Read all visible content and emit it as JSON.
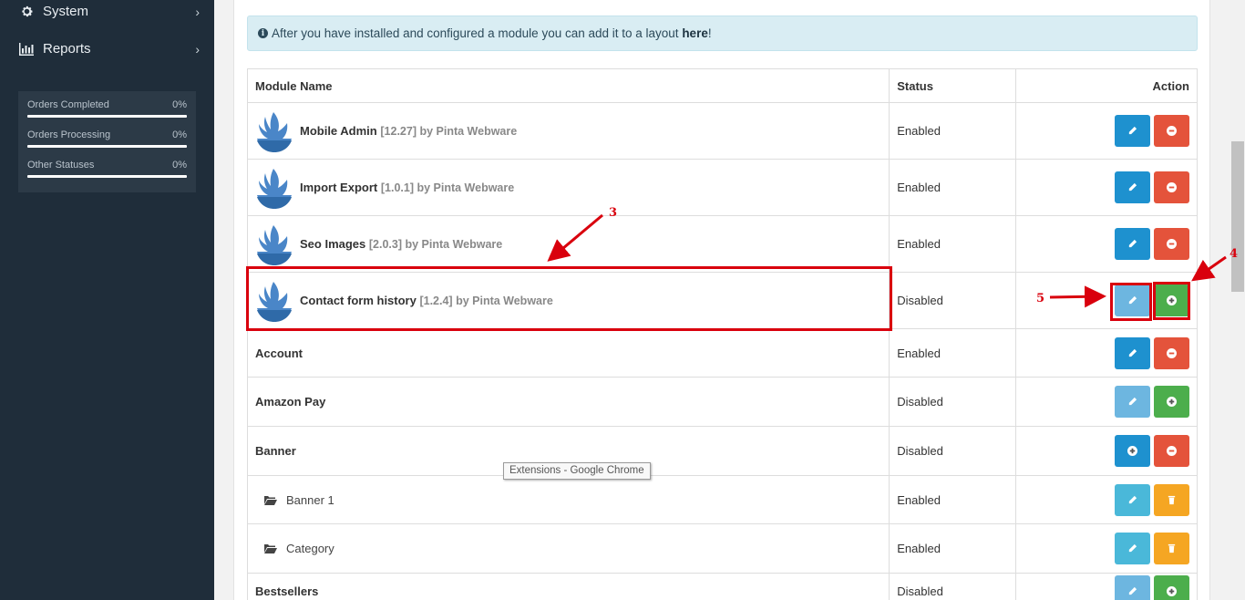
{
  "sidebar": {
    "items": [
      {
        "label": "System",
        "icon": "gear-icon"
      },
      {
        "label": "Reports",
        "icon": "bar-chart-icon"
      }
    ],
    "stats": [
      {
        "label": "Orders Completed",
        "value": "0%"
      },
      {
        "label": "Orders Processing",
        "value": "0%"
      },
      {
        "label": "Other Statuses",
        "value": "0%"
      }
    ]
  },
  "alert": {
    "text": "After you have installed and configured a module you can add it to a layout",
    "link": "here",
    "suffix": "!"
  },
  "table": {
    "headers": {
      "name": "Module Name",
      "status": "Status",
      "action": "Action"
    },
    "rows": [
      {
        "name": "Mobile Admin",
        "meta": "[12.27] by Pinta Webware",
        "status": "Enabled"
      },
      {
        "name": "Import Export",
        "meta": "[1.0.1] by Pinta Webware",
        "status": "Enabled"
      },
      {
        "name": "Seo Images",
        "meta": "[2.0.3] by Pinta Webware",
        "status": "Enabled"
      },
      {
        "name": "Contact form history",
        "meta": "[1.2.4] by Pinta Webware",
        "status": "Disabled"
      },
      {
        "name": "Account",
        "status": "Enabled"
      },
      {
        "name": "Amazon Pay",
        "status": "Disabled"
      },
      {
        "name": "Banner",
        "status": "Disabled"
      },
      {
        "name": "Banner 1",
        "status": "Enabled"
      },
      {
        "name": "Category",
        "status": "Enabled"
      },
      {
        "name": "Bestsellers",
        "status": "Disabled"
      }
    ]
  },
  "annotations": {
    "n3": "3",
    "n4": "4",
    "n5": "5"
  },
  "tooltip": "Extensions - Google Chrome",
  "colors": {
    "sidebar": "#1f2d3a",
    "primary": "#1e91cf",
    "danger": "#e4533b",
    "success": "#4cae4c",
    "warning": "#f5a623",
    "annotation": "#d9000d"
  }
}
